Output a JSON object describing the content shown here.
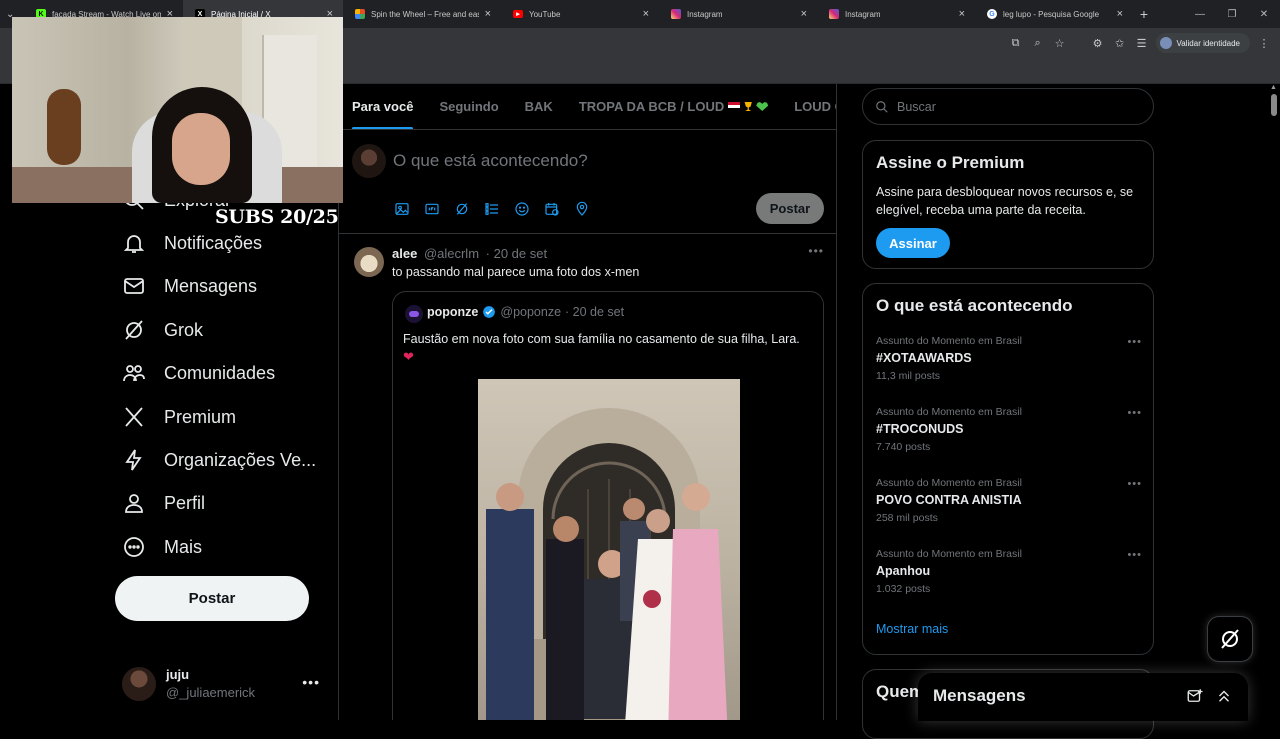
{
  "browser": {
    "tabs": [
      {
        "label": "facada Stream - Watch Live on",
        "icon": "kick-icon",
        "color": "#53fc18"
      },
      {
        "label": "Página Inicial / X",
        "icon": "x-icon",
        "color": "#000000"
      },
      {
        "label": "Spin the Wheel – Free and easy",
        "icon": "wheel-icon",
        "color": "#e44d26"
      },
      {
        "label": "YouTube",
        "icon": "youtube-icon",
        "color": "#ff0000"
      },
      {
        "label": "Instagram",
        "icon": "instagram-icon",
        "color": "#d6249f"
      },
      {
        "label": "Instagram",
        "icon": "instagram-icon",
        "color": "#d6249f"
      },
      {
        "label": "leg lupo - Pesquisa Google",
        "icon": "google-icon",
        "color": "#4285f4"
      }
    ],
    "active_tab_index": 1,
    "identity_label": "Validar identidade"
  },
  "overlay": {
    "subs_text": "SUBS 20/25"
  },
  "sidebar": {
    "items": [
      {
        "label": "Explorar",
        "icon": "search-icon"
      },
      {
        "label": "Notificações",
        "icon": "bell-icon"
      },
      {
        "label": "Mensagens",
        "icon": "mail-icon"
      },
      {
        "label": "Grok",
        "icon": "grok-icon"
      },
      {
        "label": "Comunidades",
        "icon": "communities-icon"
      },
      {
        "label": "Premium",
        "icon": "x-logo-icon"
      },
      {
        "label": "Organizações Ve...",
        "icon": "lightning-icon"
      },
      {
        "label": "Perfil",
        "icon": "person-icon"
      },
      {
        "label": "Mais",
        "icon": "more-circle-icon"
      }
    ],
    "post_button": "Postar",
    "account": {
      "name": "juju",
      "handle": "@_juliaemerick"
    }
  },
  "timeline": {
    "tabs": [
      "Para você",
      "Seguindo",
      "BAK",
      "TROPA DA BCB / LOUD",
      "LOUD Co"
    ],
    "composer": {
      "placeholder": "O que está acontecendo?",
      "post_button": "Postar"
    },
    "tweet": {
      "name": "alee",
      "handle": "@alecrlm",
      "date": "· 20 de set",
      "text": "to passando mal parece uma foto dos x-men",
      "quote": {
        "name": "poponze",
        "handle": "@poponze",
        "date": "· 20 de set",
        "text": "Faustão em nova foto com sua família no casamento de sua filha, Lara."
      }
    }
  },
  "right": {
    "search_placeholder": "Buscar",
    "premium": {
      "title": "Assine o Premium",
      "text": "Assine para desbloquear novos recursos e, se elegível, receba uma parte da receita.",
      "button": "Assinar"
    },
    "trends": {
      "title": "O que está acontecendo",
      "items": [
        {
          "context": "Assunto do Momento em Brasil",
          "name": "#XOTAAWARDS",
          "count": "11,3 mil posts"
        },
        {
          "context": "Assunto do Momento em Brasil",
          "name": "#TROCONUDS",
          "count": "7.740 posts"
        },
        {
          "context": "Assunto do Momento em Brasil",
          "name": "POVO CONTRA ANISTIA",
          "count": "258 mil posts"
        },
        {
          "context": "Assunto do Momento em Brasil",
          "name": "Apanhou",
          "count": "1.032 posts"
        }
      ],
      "show_more": "Mostrar mais"
    },
    "who_to_follow_title": "Quem"
  },
  "messages_drawer": {
    "title": "Mensagens"
  },
  "colors": {
    "accent": "#1d9bf0",
    "background": "#000000",
    "border": "#2f3336",
    "muted": "#71767b"
  }
}
